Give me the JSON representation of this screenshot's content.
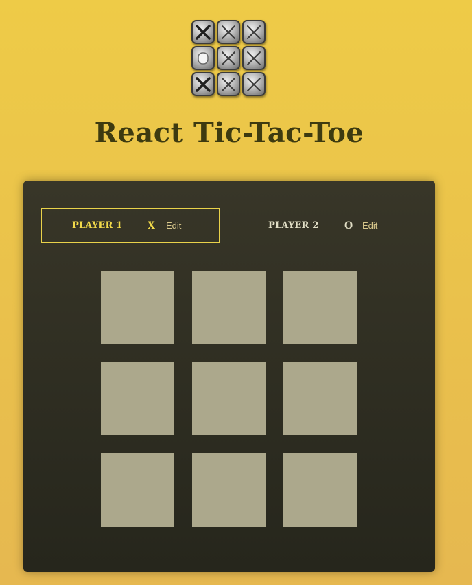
{
  "header": {
    "title": "React Tic-Tac-Toe",
    "logo": {
      "tiles": [
        "x",
        "x",
        "x",
        "o",
        "x",
        "x",
        "x",
        "x",
        "x"
      ]
    }
  },
  "players": [
    {
      "name": "Player 1",
      "symbol": "X",
      "edit_label": "Edit",
      "active": true
    },
    {
      "name": "Player 2",
      "symbol": "O",
      "edit_label": "Edit",
      "active": false
    }
  ],
  "board": {
    "cells": [
      "",
      "",
      "",
      "",
      "",
      "",
      "",
      "",
      ""
    ]
  },
  "colors": {
    "background": "#eecb47",
    "panel": "#2f2e22",
    "active_accent": "#f1d94a",
    "cell": "#aca88c",
    "title": "#3d3a10"
  }
}
